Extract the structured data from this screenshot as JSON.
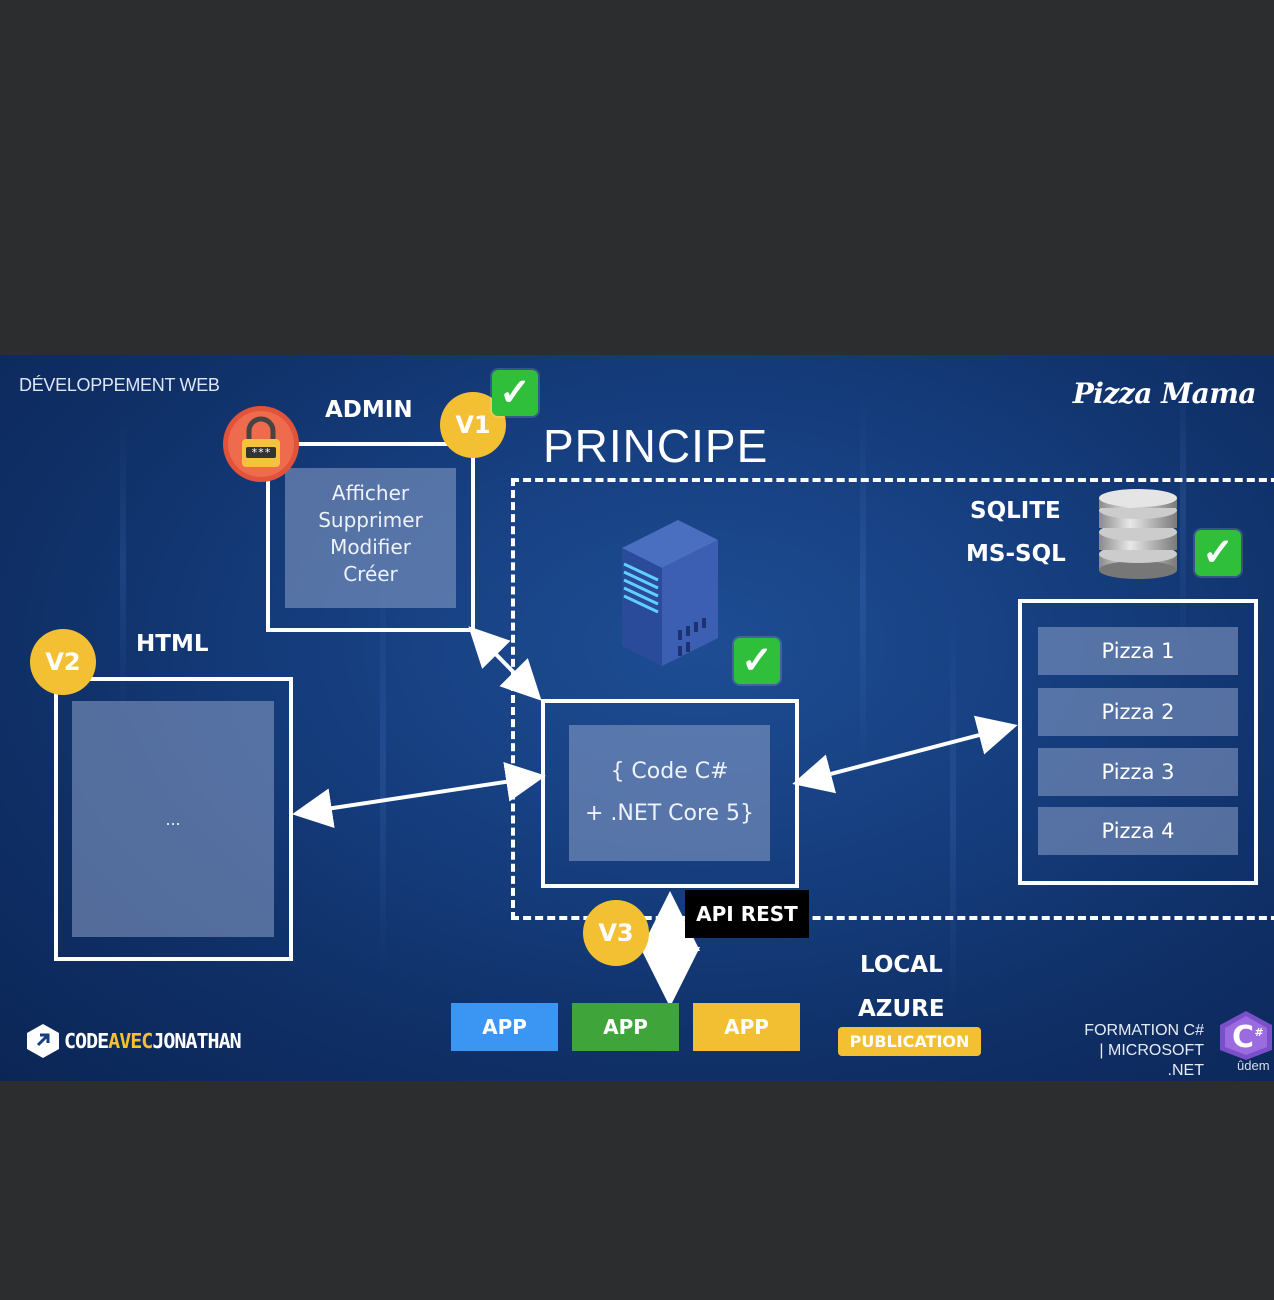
{
  "header": {
    "section": "DÉVELOPPEMENT WEB",
    "brand": "Pizza Mama",
    "title": "PRINCIPE"
  },
  "admin": {
    "label": "ADMIN",
    "actions": [
      "Afficher",
      "Supprimer",
      "Modifier",
      "Créer"
    ],
    "badge": "V1",
    "lock_icon": "lock-icon"
  },
  "html_block": {
    "label": "HTML",
    "content": "...",
    "badge": "V2"
  },
  "server": {
    "line1": "{ Code C#",
    "line2": "+ .NET Core 5}",
    "icon": "server-icon"
  },
  "database": {
    "label1": "SQLITE",
    "label2": "MS-SQL",
    "icon": "database-icon",
    "items": [
      "Pizza 1",
      "Pizza 2",
      "Pizza 3",
      "Pizza 4"
    ]
  },
  "api": {
    "label": "API REST",
    "badge": "V3"
  },
  "apps": [
    {
      "label": "APP",
      "color": "#3a96f2"
    },
    {
      "label": "APP",
      "color": "#3fa53b"
    },
    {
      "label": "APP",
      "color": "#f2bf33"
    }
  ],
  "deploy": {
    "local": "LOCAL",
    "azure": "AZURE",
    "publication": "PUBLICATION"
  },
  "footer": {
    "logo_prefix": "CODE",
    "logo_avec": "AVEC",
    "logo_suffix": "JONATHAN",
    "formation_line1": "FORMATION C#",
    "formation_line2": "| MICROSOFT .NET",
    "udemy": "ûdem"
  },
  "colors": {
    "badge": "#f4c033",
    "check": "#2fbf3a",
    "background": "#163f80"
  }
}
